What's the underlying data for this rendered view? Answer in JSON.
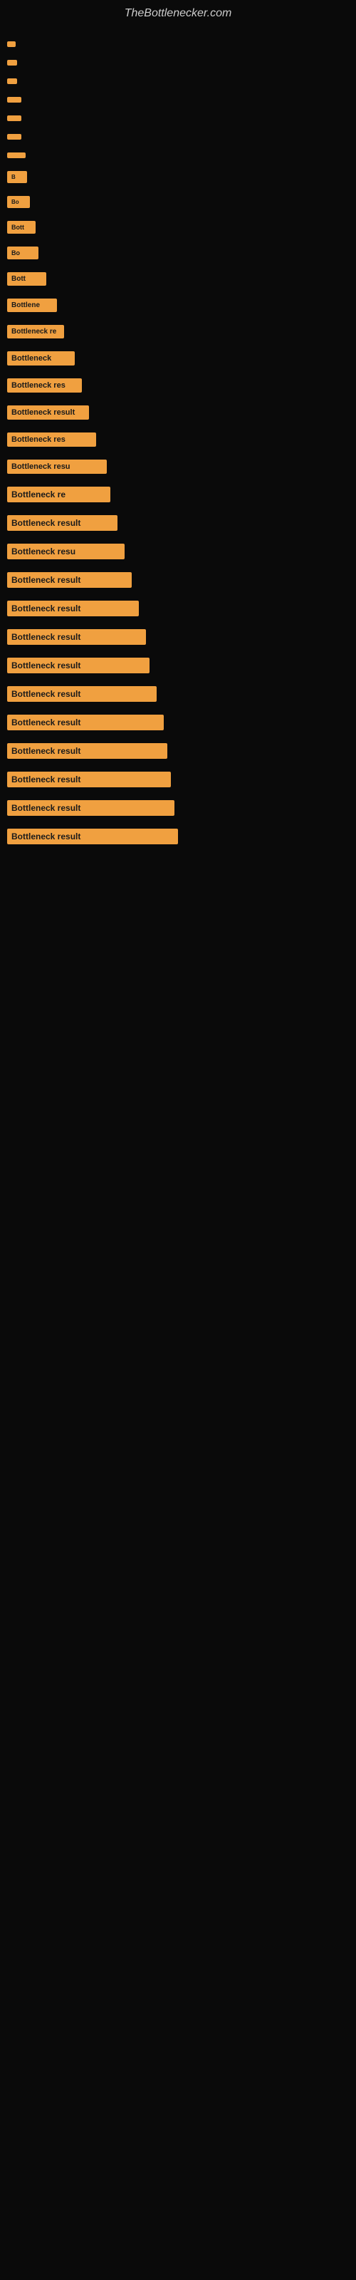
{
  "site": {
    "title": "TheBottlenecker.com"
  },
  "bars": [
    {
      "id": 1,
      "label": ""
    },
    {
      "id": 2,
      "label": ""
    },
    {
      "id": 3,
      "label": ""
    },
    {
      "id": 4,
      "label": ""
    },
    {
      "id": 5,
      "label": ""
    },
    {
      "id": 6,
      "label": ""
    },
    {
      "id": 7,
      "label": ""
    },
    {
      "id": 8,
      "label": "B"
    },
    {
      "id": 9,
      "label": "Bo"
    },
    {
      "id": 10,
      "label": "Bott"
    },
    {
      "id": 11,
      "label": "Bo"
    },
    {
      "id": 12,
      "label": "Bott"
    },
    {
      "id": 13,
      "label": "Bottlene"
    },
    {
      "id": 14,
      "label": "Bottleneck re"
    },
    {
      "id": 15,
      "label": "Bottleneck"
    },
    {
      "id": 16,
      "label": "Bottleneck res"
    },
    {
      "id": 17,
      "label": "Bottleneck result"
    },
    {
      "id": 18,
      "label": "Bottleneck res"
    },
    {
      "id": 19,
      "label": "Bottleneck resu"
    },
    {
      "id": 20,
      "label": "Bottleneck re"
    },
    {
      "id": 21,
      "label": "Bottleneck result"
    },
    {
      "id": 22,
      "label": "Bottleneck resu"
    },
    {
      "id": 23,
      "label": "Bottleneck result"
    },
    {
      "id": 24,
      "label": "Bottleneck result"
    },
    {
      "id": 25,
      "label": "Bottleneck result"
    },
    {
      "id": 26,
      "label": "Bottleneck result"
    },
    {
      "id": 27,
      "label": "Bottleneck result"
    },
    {
      "id": 28,
      "label": "Bottleneck result"
    },
    {
      "id": 29,
      "label": "Bottleneck result"
    },
    {
      "id": 30,
      "label": "Bottleneck result"
    },
    {
      "id": 31,
      "label": "Bottleneck result"
    },
    {
      "id": 32,
      "label": "Bottleneck result"
    }
  ]
}
